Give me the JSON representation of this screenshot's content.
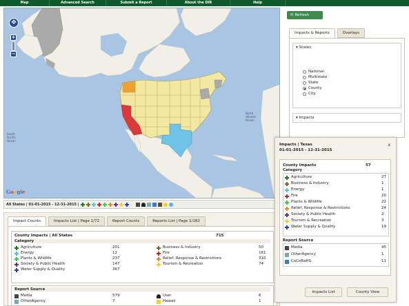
{
  "nav": [
    "Map",
    "Advanced Search",
    "Submit a Report",
    "About the DIR",
    "Help"
  ],
  "map": {
    "labels": {
      "north_atlantic": "North\nAtlantic\nOcean",
      "south_pacific": "South\nPacific\nOcean"
    },
    "zoom_in": "+",
    "zoom_out": "−",
    "google": [
      "G",
      "o",
      "o",
      "g",
      "l",
      "e"
    ],
    "colors": {
      "water": "#a8c6e4",
      "land": "#f1efe6",
      "us_states": "#f3e8a0",
      "texas": "#6ec3e6",
      "california": "#dc3a3a",
      "washington": "#f0a030",
      "gray": "#aaaaaa"
    }
  },
  "filter_bar": {
    "text": "All States | 01-01-2015 - 12-31-2015 |"
  },
  "lower": {
    "tabs": [
      "Impact Counts",
      "Impacts List | Page 1/72",
      "Report Counts",
      "Reports List | Page 1/182"
    ],
    "header": "County Impacts | All States",
    "header_count": "715",
    "category_label": "Category",
    "categories_left": [
      {
        "label": "Agriculture",
        "value": "201",
        "color": "#1a7a1a"
      },
      {
        "label": "Energy",
        "value": "12",
        "color": "#4ec9e8"
      },
      {
        "label": "Plants & Wildlife",
        "value": "237",
        "color": "#2fd04a"
      },
      {
        "label": "Society & Public Health",
        "value": "147",
        "color": "#6a2a8a"
      },
      {
        "label": "Water Supply & Quality",
        "value": "367",
        "color": "#2240c8"
      }
    ],
    "categories_right": [
      {
        "label": "Business & Industry",
        "value": "50",
        "color": "#7a6a1a"
      },
      {
        "label": "Fire",
        "value": "161",
        "color": "#d42020"
      },
      {
        "label": "Relief, Response & Restrictions",
        "value": "310",
        "color": "#e88a1a"
      },
      {
        "label": "Tourism & Recreation",
        "value": "74",
        "color": "#f0d020"
      }
    ],
    "report_source_label": "Report Source",
    "sources_left": [
      {
        "label": "Media",
        "value": "579"
      },
      {
        "label": "OtherAgency",
        "value": "7"
      }
    ],
    "sources_right": [
      {
        "label": "User",
        "value": "6"
      },
      {
        "label": "Hawaii",
        "value": "1"
      }
    ]
  },
  "right": {
    "refresh": "Refresh",
    "tabs": [
      "Impacts & Reports",
      "Overlays"
    ],
    "scales_label": "Scales",
    "scales": [
      {
        "label": "National",
        "checked": false
      },
      {
        "label": "Multistate",
        "checked": false
      },
      {
        "label": "State",
        "checked": false
      },
      {
        "label": "County",
        "checked": true
      },
      {
        "label": "City",
        "checked": false
      }
    ],
    "impacts_label": "Impacts"
  },
  "popup": {
    "title": "Impacts | Texas",
    "close": "x",
    "date_range": "01-01-2015 - 12-31-2015",
    "county_impacts": "County Impacts",
    "county_total": "57",
    "category_label": "Category",
    "categories": [
      {
        "label": "Agriculture",
        "value": "27",
        "color": "#1a7a1a"
      },
      {
        "label": "Business & Industry",
        "value": "1",
        "color": "#7a6a1a"
      },
      {
        "label": "Energy",
        "value": "1",
        "color": "#4ec9e8"
      },
      {
        "label": "Fire",
        "value": "20",
        "color": "#d42020"
      },
      {
        "label": "Plants & Wildlife",
        "value": "22",
        "color": "#2fd04a"
      },
      {
        "label": "Relief, Response & Restrictions",
        "value": "24",
        "color": "#e88a1a"
      },
      {
        "label": "Society & Public Health",
        "value": "2",
        "color": "#6a2a8a"
      },
      {
        "label": "Tourism & Recreation",
        "value": "3",
        "color": "#f0d020"
      },
      {
        "label": "Water Supply & Quality",
        "value": "19",
        "color": "#2240c8"
      }
    ],
    "report_source_label": "Report Source",
    "sources": [
      {
        "label": "Media",
        "value": "45"
      },
      {
        "label": "OtherAgency",
        "value": "1"
      },
      {
        "label": "CoCoRaHS",
        "value": "11"
      }
    ],
    "btn_impacts": "Impacts List",
    "btn_county": "County View"
  }
}
